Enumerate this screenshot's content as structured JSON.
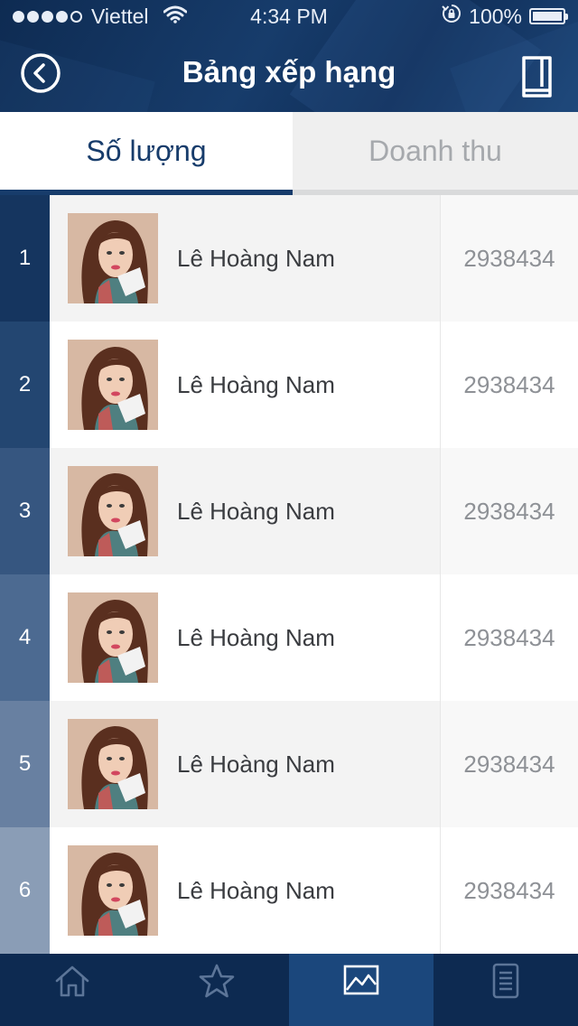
{
  "status_bar": {
    "carrier": "Viettel",
    "time": "4:34 PM",
    "battery": "100%",
    "signal_bars": 4,
    "signal_total": 5
  },
  "nav": {
    "title": "Bảng xếp hạng",
    "left_icon": "back-circle-icon",
    "right_icon": "book-icon"
  },
  "tabs": [
    {
      "label": "Số lượng",
      "active": true
    },
    {
      "label": "Doanh thu",
      "active": false
    }
  ],
  "ranking": [
    {
      "rank": "1",
      "name": "Lê Hoàng Nam",
      "score": "2938434"
    },
    {
      "rank": "2",
      "name": "Lê Hoàng Nam",
      "score": "2938434"
    },
    {
      "rank": "3",
      "name": "Lê Hoàng Nam",
      "score": "2938434"
    },
    {
      "rank": "4",
      "name": "Lê Hoàng Nam",
      "score": "2938434"
    },
    {
      "rank": "5",
      "name": "Lê Hoàng Nam",
      "score": "2938434"
    },
    {
      "rank": "6",
      "name": "Lê Hoàng Nam",
      "score": "2938434"
    }
  ],
  "rank_colors": [
    "#15355f",
    "#234671",
    "#365680",
    "#4c6a91",
    "#6880a1",
    "#8a9db6"
  ],
  "bottom_nav": [
    {
      "icon": "home-icon",
      "active": false
    },
    {
      "icon": "star-icon",
      "active": false
    },
    {
      "icon": "chart-icon",
      "active": true
    },
    {
      "icon": "document-icon",
      "active": false
    }
  ],
  "colors": {
    "primary": "#173c6b",
    "bottom_bar": "#0d2a51",
    "bottom_bar_active": "#1b477c"
  }
}
